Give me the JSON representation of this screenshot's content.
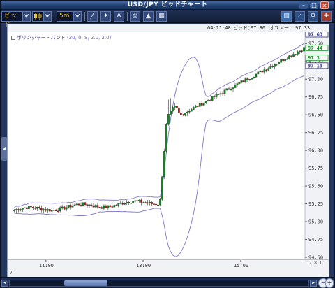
{
  "window": {
    "title": "USD/JPY ビッドチャート"
  },
  "toolbar": {
    "rate_type": "ビッド",
    "chart_type_icon": "candle-icon",
    "timeframe": "5m"
  },
  "info": {
    "time": "04:11:48",
    "bid_label": "ビッド：",
    "bid": "97.30",
    "offer_label": "オファー：",
    "offer": "97.33"
  },
  "indicator": {
    "name": "ボリンジャー・バンド",
    "params": "(20, 0, S, 2.0, 2.0)"
  },
  "yaxis": {
    "ticks": [
      "97.50",
      "97.25",
      "97.00",
      "96.75",
      "96.50",
      "96.25",
      "96.00",
      "95.75",
      "95.50",
      "95.25",
      "95.00",
      "94.75",
      "94.50"
    ],
    "markers": [
      {
        "label": "97.63",
        "value": 97.63,
        "color": "#2a2a8a"
      },
      {
        "label": "97.44",
        "value": 97.44,
        "color": "#1d8a2a"
      },
      {
        "label": "97.3",
        "value": 97.3,
        "color": "#1d8a2a"
      },
      {
        "label": "97.19",
        "value": 97.19,
        "color": "#2a2a8a"
      }
    ],
    "scale_label": "7.8.1"
  },
  "xaxis": {
    "labels": [
      "11:00",
      "13:00",
      "15:00"
    ],
    "corner": "7"
  },
  "colors": {
    "up": "#0a8a1a",
    "down": "#b01818",
    "band": "#7d78c8",
    "ma": "#7d78c8"
  },
  "chart_data": {
    "type": "candlestick",
    "title": "USD/JPY",
    "ylim": [
      94.5,
      97.63
    ],
    "xlabels": [
      "11:00",
      "13:00",
      "15:00"
    ],
    "indicator": "Bollinger Bands (20, 0, S, 2.0, 2.0)"
  }
}
